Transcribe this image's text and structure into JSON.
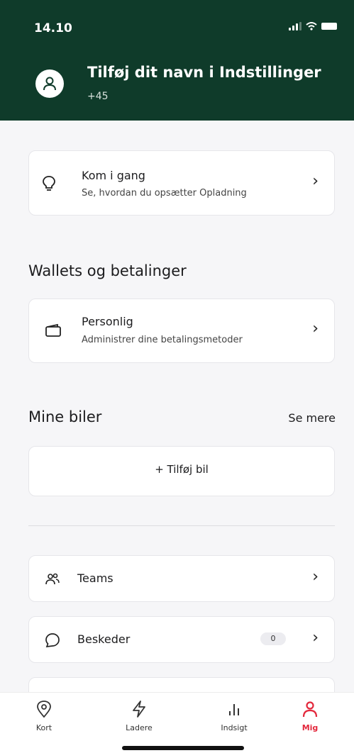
{
  "status_bar": {
    "time": "14.10",
    "icons": [
      "signal-icon",
      "wifi-icon",
      "battery-icon"
    ]
  },
  "profile": {
    "name": "Tilføj dit navn i Indstillinger",
    "phone": "+45",
    "icon": "user-icon"
  },
  "get_started": {
    "title": "Kom i gang",
    "subtitle": "Se, hvordan du opsætter Opladning",
    "icon": "lightbulb-icon"
  },
  "wallets": {
    "section_title": "Wallets og betalinger",
    "item": {
      "title": "Personlig",
      "subtitle": "Administrer dine betalingsmetoder",
      "icon": "wallet-icon"
    }
  },
  "cars": {
    "section_title": "Mine biler",
    "see_more": "Se mere",
    "add_label": "+ Tilføj bil"
  },
  "menu": {
    "teams": {
      "label": "Teams",
      "icon": "people-icon"
    },
    "messages": {
      "label": "Beskeder",
      "badge": "0",
      "icon": "chat-bubble-icon"
    }
  },
  "tabbar": {
    "tabs": [
      {
        "label": "Kort",
        "icon": "map-pin-icon",
        "active": false
      },
      {
        "label": "Ladere",
        "icon": "lightning-icon",
        "active": false
      },
      {
        "label": "Indsigt",
        "icon": "bar-chart-icon",
        "active": false
      },
      {
        "label": "Mig",
        "icon": "person-icon",
        "active": true
      }
    ]
  },
  "colors": {
    "header_bg": "#0f3b2a",
    "active_tab": "#e3283c",
    "page_bg": "#f6f6f8"
  }
}
